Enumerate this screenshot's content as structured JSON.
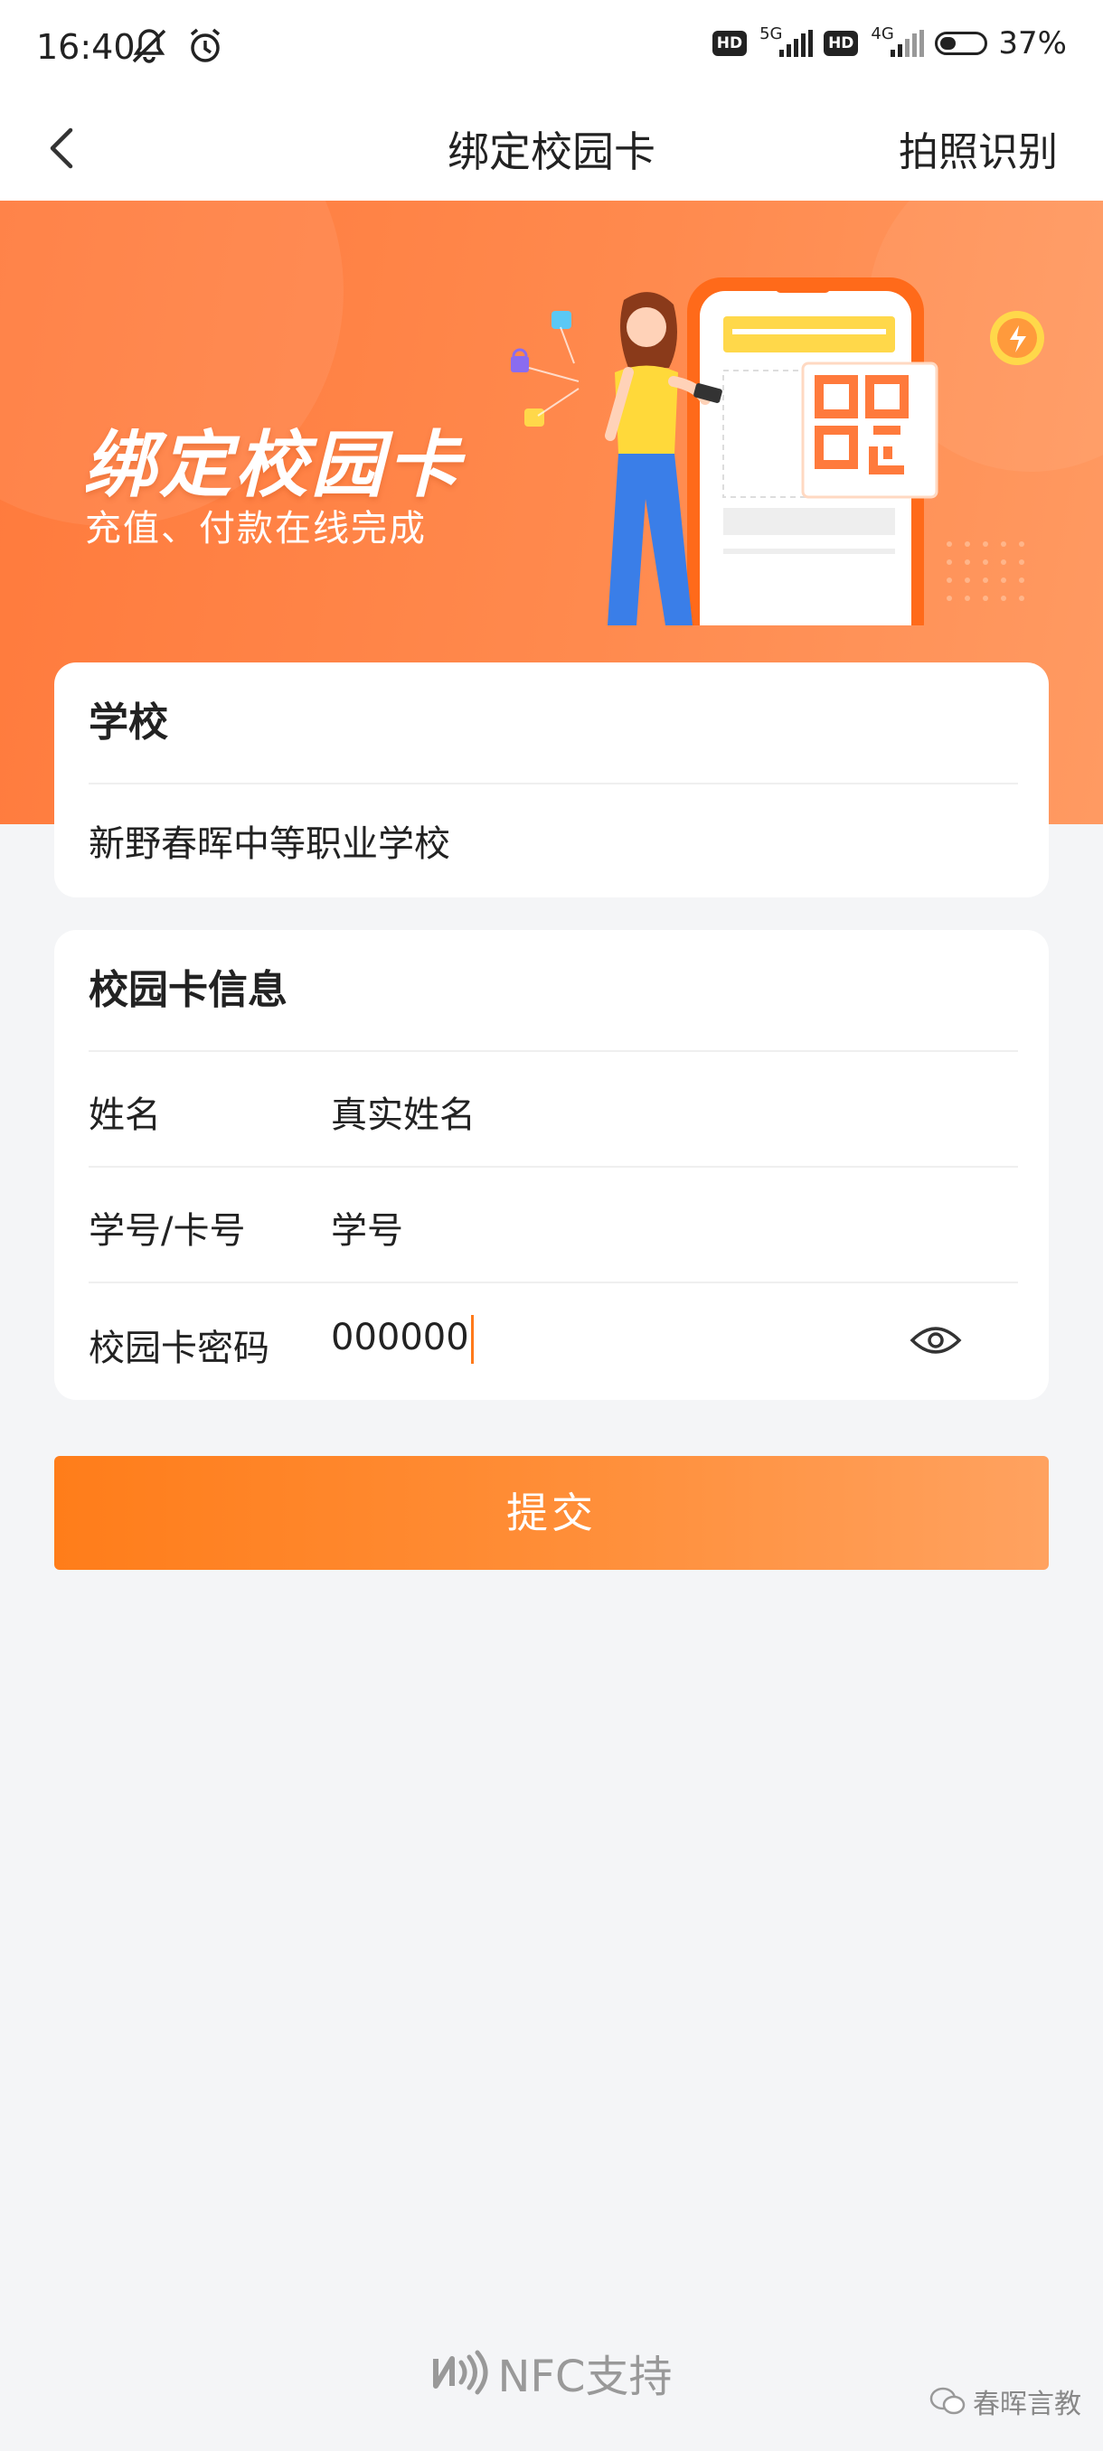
{
  "status_bar": {
    "time": "16:40",
    "net1": "5G",
    "net2": "4G",
    "hd": "HD",
    "battery": "37%"
  },
  "nav": {
    "title": "绑定校园卡",
    "right_action": "拍照识别"
  },
  "banner": {
    "title": "绑定校园卡",
    "subtitle": "充值、付款在线完成"
  },
  "school_card": {
    "heading": "学校",
    "school_name": "新野春晖中等职业学校"
  },
  "info_card": {
    "heading": "校园卡信息",
    "rows": [
      {
        "label": "姓名",
        "value": "真实姓名"
      },
      {
        "label": "学号/卡号",
        "value": "学号"
      },
      {
        "label": "校园卡密码",
        "value": "000000"
      }
    ]
  },
  "submit_label": "提交",
  "footer": {
    "nfc_label": "NFC支持",
    "watermark": "春晖言教"
  },
  "colors": {
    "accent": "#ff7d1a",
    "banner": "#ff8a4e",
    "background": "#f4f5f7"
  },
  "icons": [
    "mute-icon",
    "alarm-icon",
    "signal-icon",
    "battery-icon",
    "back-chevron-icon",
    "eye-icon",
    "nfc-icon",
    "wechat-icon"
  ]
}
